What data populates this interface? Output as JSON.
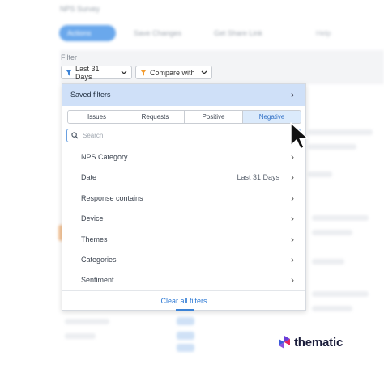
{
  "background": {
    "title": "NPS Survey",
    "buttons": [
      "Actions",
      "Save Changes",
      "Get Share Link",
      "Help"
    ]
  },
  "filter_bar": {
    "label": "Filter",
    "date_chip": "Last 31 Days",
    "compare_chip": "Compare with"
  },
  "dropdown": {
    "saved_filters": "Saved filters",
    "tabs": [
      "Issues",
      "Requests",
      "Positive",
      "Negative"
    ],
    "active_tab": "Negative",
    "search_placeholder": "Search",
    "items": [
      {
        "label": "NPS Category",
        "value": ""
      },
      {
        "label": "Date",
        "value": "Last 31 Days"
      },
      {
        "label": "Response contains",
        "value": ""
      },
      {
        "label": "Device",
        "value": ""
      },
      {
        "label": "Themes",
        "value": ""
      },
      {
        "label": "Categories",
        "value": ""
      },
      {
        "label": "Sentiment",
        "value": ""
      }
    ],
    "clear_all": "Clear all filters"
  },
  "brand": {
    "name": "thematic"
  },
  "colors": {
    "accent": "#3b82d6",
    "saved_bg": "#cfe0f8",
    "active_tab_bg": "#dbeafb",
    "compare_icon": "#f39b2e"
  },
  "icons": [
    "filter-icon",
    "chevron-down-icon",
    "chevron-right-icon",
    "search-icon",
    "mouse-cursor-icon",
    "thematic-logo-icon"
  ]
}
